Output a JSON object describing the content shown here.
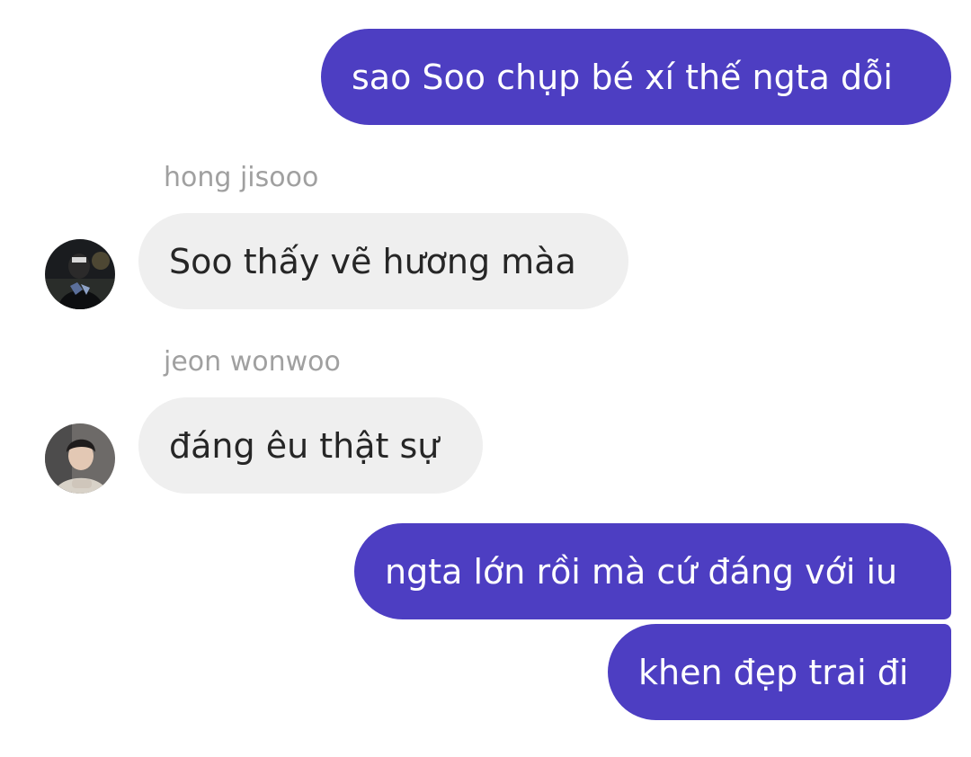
{
  "conversation": {
    "messages": [
      {
        "direction": "outgoing",
        "text": "sao Soo chụp bé xí thế ngta dỗi"
      },
      {
        "direction": "incoming",
        "sender": "hong jisooo",
        "text": "Soo thấy vẽ hương màa"
      },
      {
        "direction": "incoming",
        "sender": "jeon wonwoo",
        "text": "đáng êu thật sự"
      },
      {
        "direction": "outgoing",
        "text": "ngta lớn rồi mà cứ đáng với iu"
      },
      {
        "direction": "outgoing",
        "text": "khen đẹp trai đi"
      }
    ]
  },
  "colors": {
    "outgoing_bubble": "#4d3ec2",
    "incoming_bubble": "#efefef",
    "sender_name": "#a0a0a0"
  },
  "icons": {
    "avatar_1": "profile-photo",
    "avatar_2": "profile-photo"
  }
}
